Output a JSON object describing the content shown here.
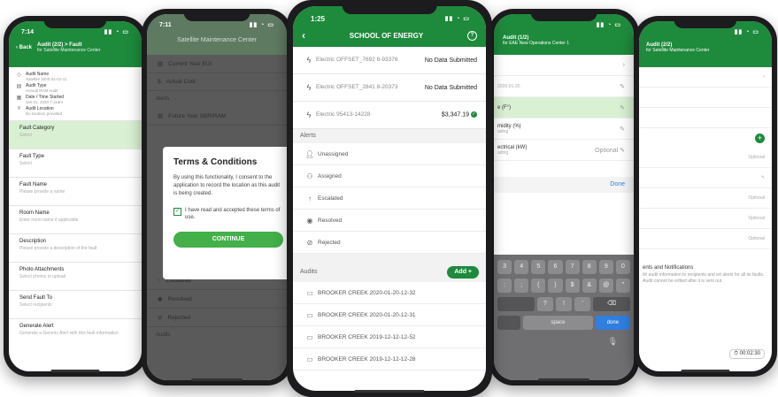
{
  "colors": {
    "brand_green": "#1e8a3c",
    "highlight_green": "#d9f0d3",
    "link_blue": "#2f7ee0"
  },
  "phone1": {
    "time": "7:14",
    "back_label": "Back",
    "title": "Audit (2/2) > Fault",
    "subtitle": "for Satellite Maintenance Center",
    "info": [
      {
        "label": "Audit Name",
        "value": "Satellite 2020-01-01-11",
        "icon": "tag-icon"
      },
      {
        "label": "Audit Type",
        "value": "Annual RAM Audit",
        "icon": "clipboard-icon"
      },
      {
        "label": "Date / Time Started",
        "value": "Jan 01, 2020 7:11am",
        "icon": "calendar-icon"
      },
      {
        "label": "Audit Location",
        "value": "No location provided",
        "icon": "pin-icon"
      }
    ],
    "fields": [
      {
        "label": "Fault Category",
        "value": "Select"
      },
      {
        "label": "Fault Type",
        "value": "Select"
      },
      {
        "label": "Fault Name",
        "value": "Please provide a name"
      },
      {
        "label": "Room Name",
        "value": "Enter room name if applicable"
      },
      {
        "label": "Description",
        "value": "Please provide a description of the fault"
      },
      {
        "label": "Photo Attachments",
        "value": "Select photos to upload"
      },
      {
        "label": "Send Fault To",
        "value": "Select recipients"
      },
      {
        "label": "Generate Alert",
        "value": "Generate a Generic Alert with this fault information"
      }
    ]
  },
  "phone2": {
    "time": "7:11",
    "title": "Satellite Maintenance Center",
    "bg_rows": [
      "Current Year EUI",
      "Actual Cost"
    ],
    "bg_section": "Alerts",
    "bg_rows2": [
      "Future Year SBR/RAM"
    ],
    "bg_rows3": [
      "Escalated",
      "Resolved",
      "Rejected"
    ],
    "bg_section2": "Audits",
    "modal": {
      "title": "Terms & Conditions",
      "body": "By using this functionality, I consent to the application to record the location as this audit is being created.",
      "checkbox_label": "I have read and accepted these terms of use.",
      "button": "CONTINUE"
    }
  },
  "phone3": {
    "time": "1:25",
    "title": "SCHOOL OF ENERGY",
    "meters": [
      {
        "name": "Electric OFFSET_7692 8-93376",
        "value": "No Data Submitted"
      },
      {
        "name": "Electric OFFSET_2841 8-20373",
        "value": "No Data Submitted"
      },
      {
        "name": "Electric 95413-14228",
        "value": "$3,347.19"
      }
    ],
    "alerts_header": "Alerts",
    "alerts": [
      {
        "label": "Unassigned",
        "icon": "person-icon"
      },
      {
        "label": "Assigned",
        "icon": "person-plus-icon"
      },
      {
        "label": "Escalated",
        "icon": "arrow-up-icon"
      },
      {
        "label": "Resolved",
        "icon": "check-circle-icon"
      },
      {
        "label": "Rejected",
        "icon": "cancel-icon"
      }
    ],
    "audits_header": "Audits",
    "add_label": "Add +",
    "audits": [
      "BROOKER CREEK 2020-01-20-12-32",
      "BROOKER CREEK 2020-01-20-12-31",
      "BROOKER CREEK 2019-12-12-12-52",
      "BROOKER CREEK 2019-12-12-12-28"
    ]
  },
  "phone4": {
    "title": "Audit (1/2)",
    "subtitle": "for EAE New Operations Center 1",
    "rows": [
      {
        "label": "",
        "value": "",
        "right": "›"
      },
      {
        "label": "",
        "value": "2020-01-20",
        "right": "✎"
      },
      {
        "label": "e (F°)",
        "value": "",
        "right": "✎"
      },
      {
        "label": "midity (%)",
        "value": "ading",
        "right": "✎"
      },
      {
        "label": "ectrical (kW)",
        "value": "ading",
        "right": "Optional ✎"
      }
    ],
    "done": "Done",
    "keys_row1": [
      "3",
      "4",
      "5",
      "6",
      "7",
      "8",
      "9",
      "0"
    ],
    "keys_row2": [
      ":",
      ";",
      "(",
      ")",
      "$",
      "&",
      "@",
      "\""
    ],
    "keys_row3": [
      "?",
      "!",
      "'"
    ],
    "space": "space",
    "done_key": "done"
  },
  "phone5": {
    "title": "Audit (2/2)",
    "subtitle": "for Satellite Maintenance Center",
    "optional": "Optional",
    "section_title": "ents and Notifications",
    "section_text": "ith audit information to recipients and ert alerts for all its faults. Audit cannot be edited after it is sent out.",
    "timer": "00:02:30"
  }
}
